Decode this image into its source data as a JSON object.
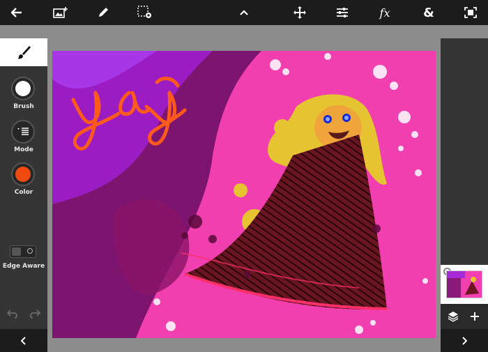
{
  "toolbar": {
    "icons": [
      "back-arrow-icon",
      "add-image-icon",
      "pencil-icon",
      "selection-settings-icon",
      "chevron-up-icon",
      "move-icon",
      "adjustments-icon",
      "fx-icon",
      "ampersand-icon",
      "fullscreen-icon"
    ],
    "fx_label": "fx",
    "amp_label": "&"
  },
  "left_panel": {
    "brush_label": "Brush",
    "mode_label": "Mode",
    "color_label": "Color",
    "edge_aware_label": "Edge Aware",
    "brush_color": "#ffffff",
    "paint_color": "#f04a10"
  },
  "canvas": {
    "background": "#f23fb0",
    "text": "yay"
  },
  "colors": {
    "toolbar": "#1c1c1c",
    "panel": "#353535",
    "workspace": "#8c8c8c"
  }
}
